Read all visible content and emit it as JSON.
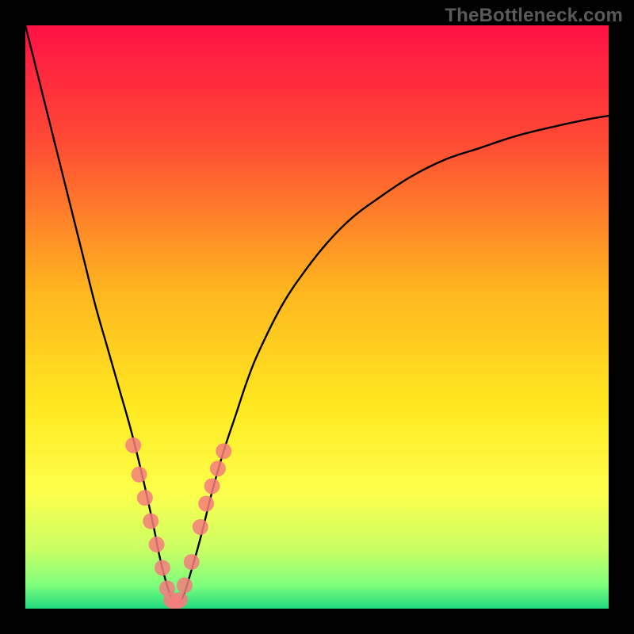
{
  "watermark": "TheBottleneck.com",
  "chart_data": {
    "type": "line",
    "title": "",
    "xlabel": "",
    "ylabel": "",
    "xlim": [
      0,
      100
    ],
    "ylim": [
      0,
      100
    ],
    "grid": false,
    "legend": false,
    "background_gradient": {
      "stops": [
        {
          "offset": 0,
          "color": "#ff1146"
        },
        {
          "offset": 20,
          "color": "#ff4b34"
        },
        {
          "offset": 45,
          "color": "#ffb41f"
        },
        {
          "offset": 65,
          "color": "#ffe81f"
        },
        {
          "offset": 80,
          "color": "#fdff4b"
        },
        {
          "offset": 90,
          "color": "#c9ff65"
        },
        {
          "offset": 96,
          "color": "#7dff7d"
        },
        {
          "offset": 100,
          "color": "#1fd97e"
        }
      ]
    },
    "series": [
      {
        "name": "curve",
        "color": "#000000",
        "x": [
          0,
          2,
          4,
          6,
          8,
          10,
          12,
          14,
          16,
          18,
          20,
          22,
          23,
          24,
          25,
          26,
          27,
          28,
          30,
          32,
          34,
          36,
          38,
          40,
          44,
          48,
          52,
          56,
          60,
          66,
          72,
          78,
          84,
          90,
          96,
          100
        ],
        "y": [
          100,
          92,
          84,
          76,
          68,
          60,
          52,
          45,
          38,
          31,
          23,
          14,
          9,
          5,
          2,
          1,
          2,
          5,
          12,
          20,
          27,
          33,
          39,
          44,
          52,
          58,
          63,
          67,
          70,
          74,
          77,
          79,
          81,
          82.5,
          83.8,
          84.5
        ]
      }
    ],
    "markers": {
      "color": "#f47d7d",
      "opacity": 0.85,
      "radius_px": 10,
      "points": [
        {
          "x": 18.5,
          "y": 28
        },
        {
          "x": 19.5,
          "y": 23
        },
        {
          "x": 20.5,
          "y": 19
        },
        {
          "x": 21.5,
          "y": 15
        },
        {
          "x": 22.5,
          "y": 11
        },
        {
          "x": 23.5,
          "y": 7
        },
        {
          "x": 24.3,
          "y": 3.5
        },
        {
          "x": 25.0,
          "y": 1.5
        },
        {
          "x": 25.7,
          "y": 1.0
        },
        {
          "x": 26.5,
          "y": 1.5
        },
        {
          "x": 27.3,
          "y": 4
        },
        {
          "x": 28.5,
          "y": 8
        },
        {
          "x": 30.0,
          "y": 14
        },
        {
          "x": 31.0,
          "y": 18
        },
        {
          "x": 32.0,
          "y": 21
        },
        {
          "x": 33.0,
          "y": 24
        },
        {
          "x": 34.0,
          "y": 27
        }
      ]
    }
  }
}
